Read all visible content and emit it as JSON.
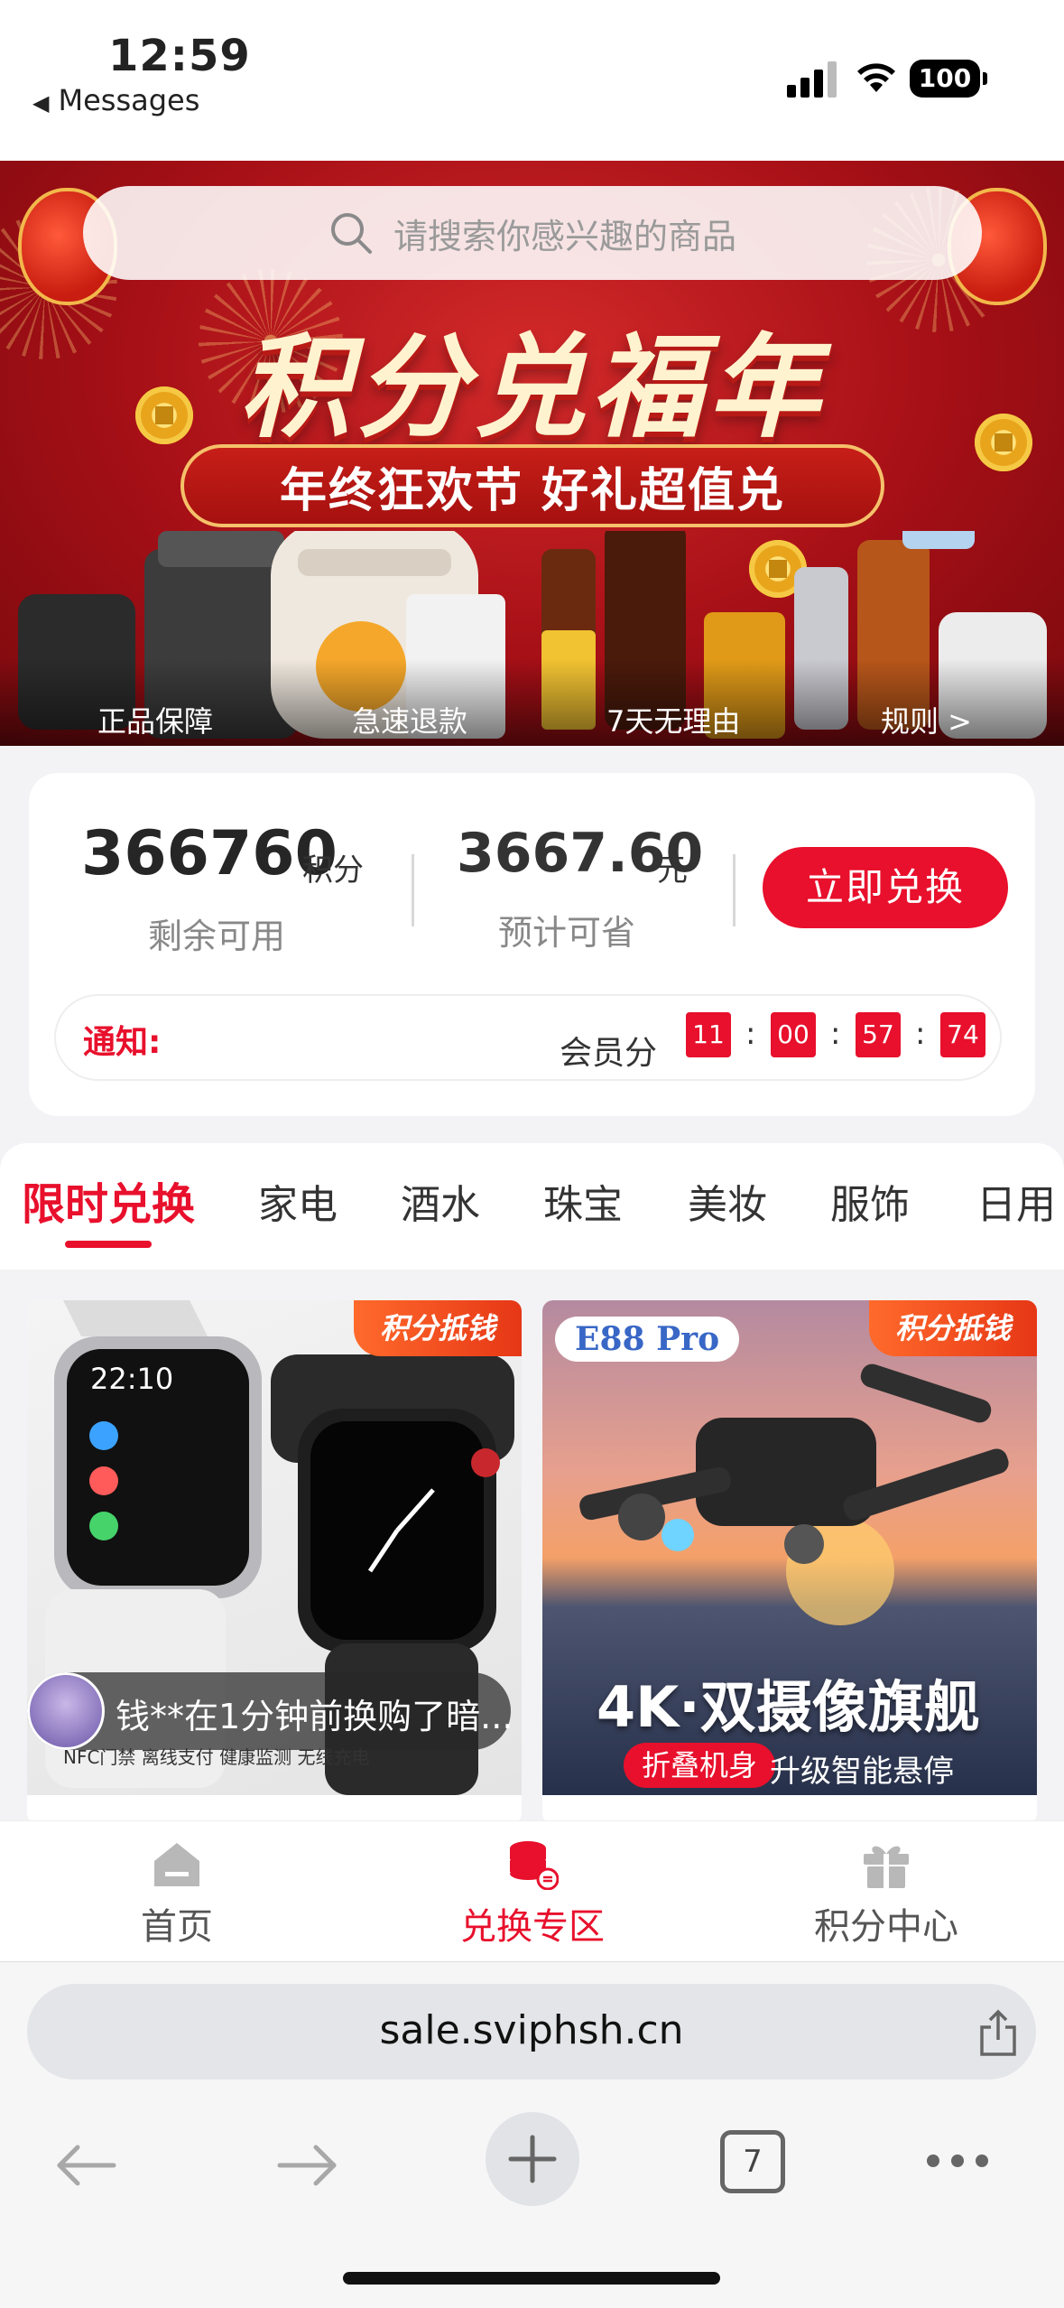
{
  "status_bar": {
    "time": "12:59",
    "back_label": "Messages",
    "battery": "100"
  },
  "banner": {
    "search_placeholder": "请搜索你感兴趣的商品",
    "headline": "积分兑福年",
    "subheadline": "年终狂欢节 好礼超值兑",
    "features": [
      "正品保障",
      "急速退款",
      "7天无理由",
      "规则 >"
    ]
  },
  "points": {
    "value": "366760",
    "unit": "积分",
    "label": "剩余可用",
    "savings_value": "3667.60",
    "savings_unit": "元",
    "savings_label": "预计可省",
    "redeem_button": "立即兑换"
  },
  "notice": {
    "label": "通知:",
    "text": "会员分",
    "countdown": [
      "11",
      "00",
      "57",
      "74"
    ]
  },
  "tabs": [
    "限时兑换",
    "家电",
    "酒水",
    "珠宝",
    "美妆",
    "服饰",
    "日用"
  ],
  "active_tab": 0,
  "products": [
    {
      "tag": "积分抵钱",
      "caption": "NFC门禁  离线支付  健康监测  无线充电"
    },
    {
      "tag": "积分抵钱",
      "badge": "E88 Pro",
      "title": "4K·双摄像旗舰",
      "pill": "折叠机身",
      "subtitle": "升级智能悬停"
    }
  ],
  "toast": {
    "text": "钱**在1分钟前换购了暗..."
  },
  "app_nav": [
    {
      "label": "首页",
      "icon": "home-icon"
    },
    {
      "label": "兑换专区",
      "icon": "coins-exchange-icon"
    },
    {
      "label": "积分中心",
      "icon": "gift-icon"
    }
  ],
  "browser": {
    "url": "sale.sviphsh.cn",
    "tab_count": "7"
  },
  "colors": {
    "accent": "#e8102c",
    "banner_red": "#a50f16"
  }
}
